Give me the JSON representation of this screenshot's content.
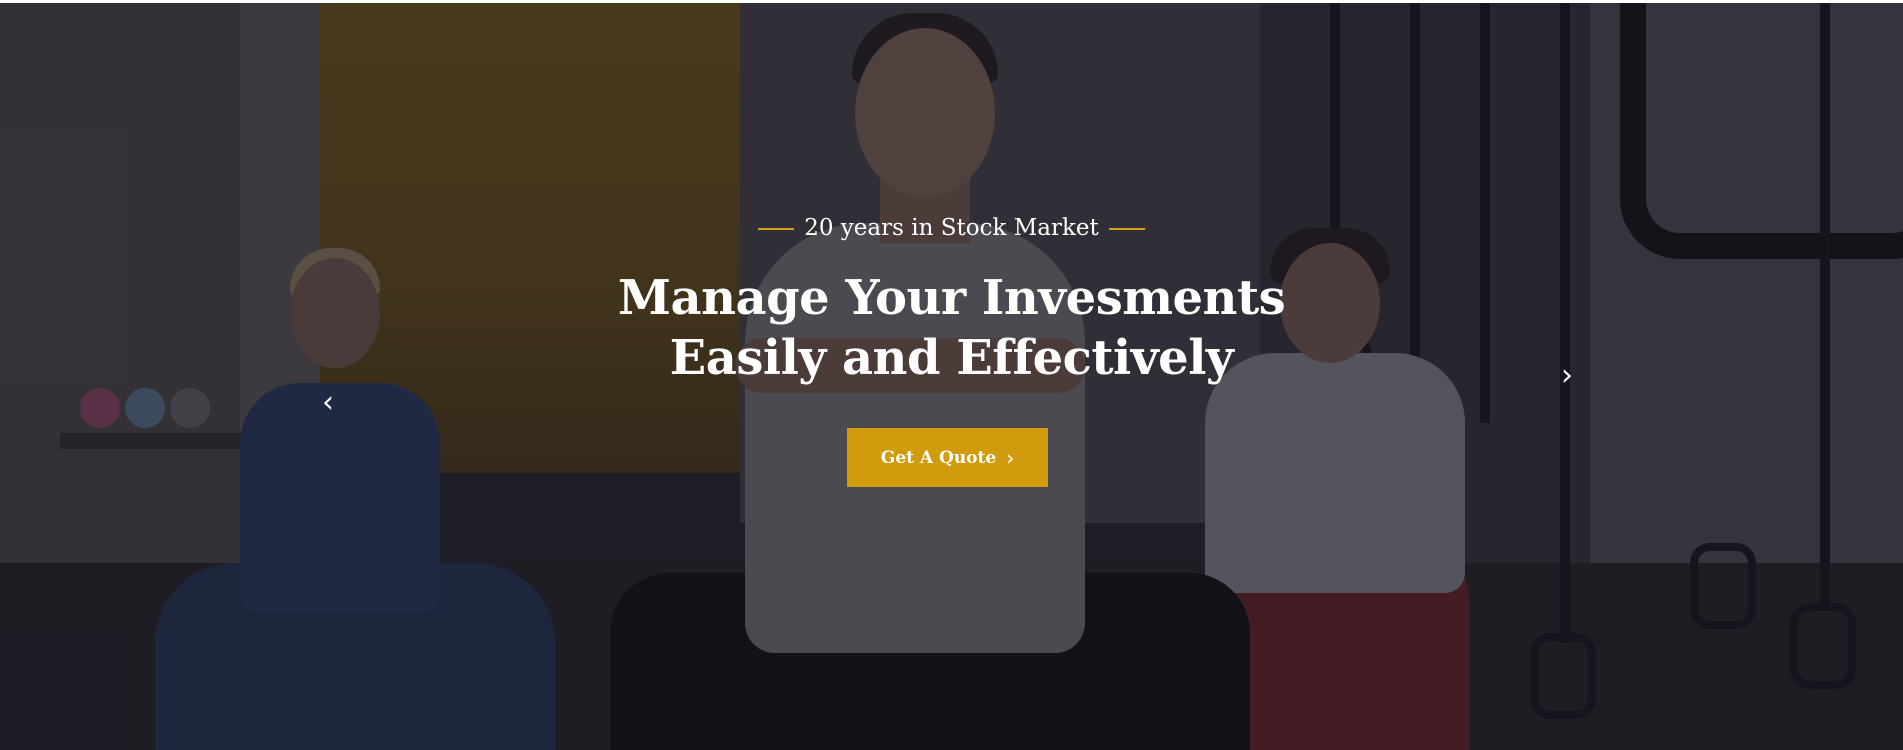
{
  "hero": {
    "eyebrow": "20 years in Stock Market",
    "title_line1": "Manage Your Invesments",
    "title_line2": "Easily and Effectively",
    "cta_label": "Get A Quote",
    "cta_icon": "chevron-right-icon",
    "prev_icon": "chevron-left-icon",
    "next_icon": "chevron-right-icon",
    "colors": {
      "accent": "#d19b0e",
      "eyebrow_line": "#d4a017",
      "text": "#ffffff"
    }
  }
}
